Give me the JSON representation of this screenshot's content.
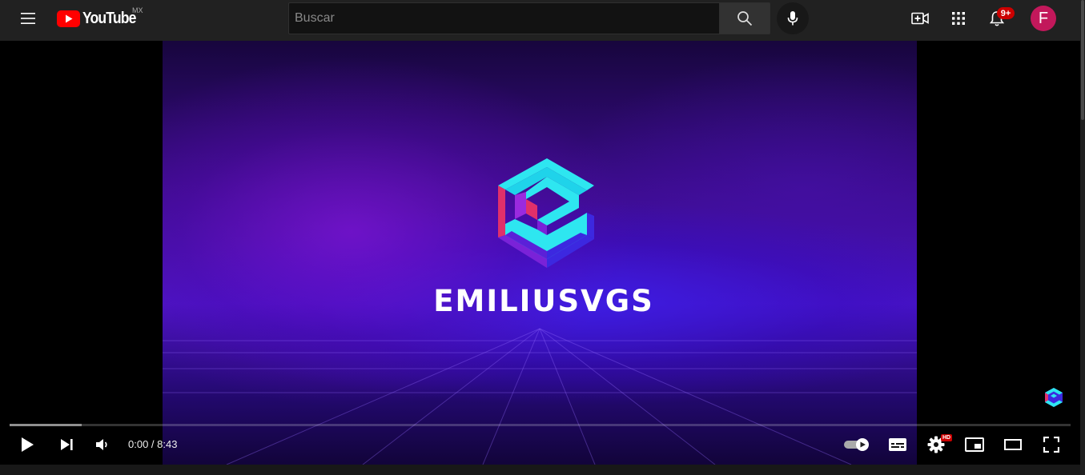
{
  "masthead": {
    "logo_text": "YouTube",
    "country_code": "MX",
    "search_placeholder": "Buscar",
    "notification_count": "9+",
    "avatar_letter": "F",
    "icons": [
      "menu-icon",
      "youtube-logo-icon",
      "search-icon",
      "microphone-icon",
      "create-video-icon",
      "apps-grid-icon",
      "bell-icon"
    ]
  },
  "video": {
    "channel_brand": "EMILIUSVGS",
    "current_time": "0:00",
    "separator": "/",
    "duration": "8:43",
    "time_display": "0:00 / 8:43",
    "loaded_fraction": 0.068,
    "played_fraction": 0,
    "quality_badge": "HD",
    "controls": [
      "play-icon",
      "next-icon",
      "volume-icon",
      "autoplay-toggle-icon",
      "subtitles-icon",
      "settings-icon",
      "miniplayer-icon",
      "theater-mode-icon",
      "fullscreen-icon"
    ]
  },
  "colors": {
    "youtube_red": "#ff0000",
    "badge_red": "#cc0000",
    "avatar": "#c2185b",
    "logo_cyan": "#2ee6f0",
    "logo_magenta": "#e0306a",
    "logo_blue": "#3c28e0",
    "logo_purple": "#7a22d8"
  }
}
